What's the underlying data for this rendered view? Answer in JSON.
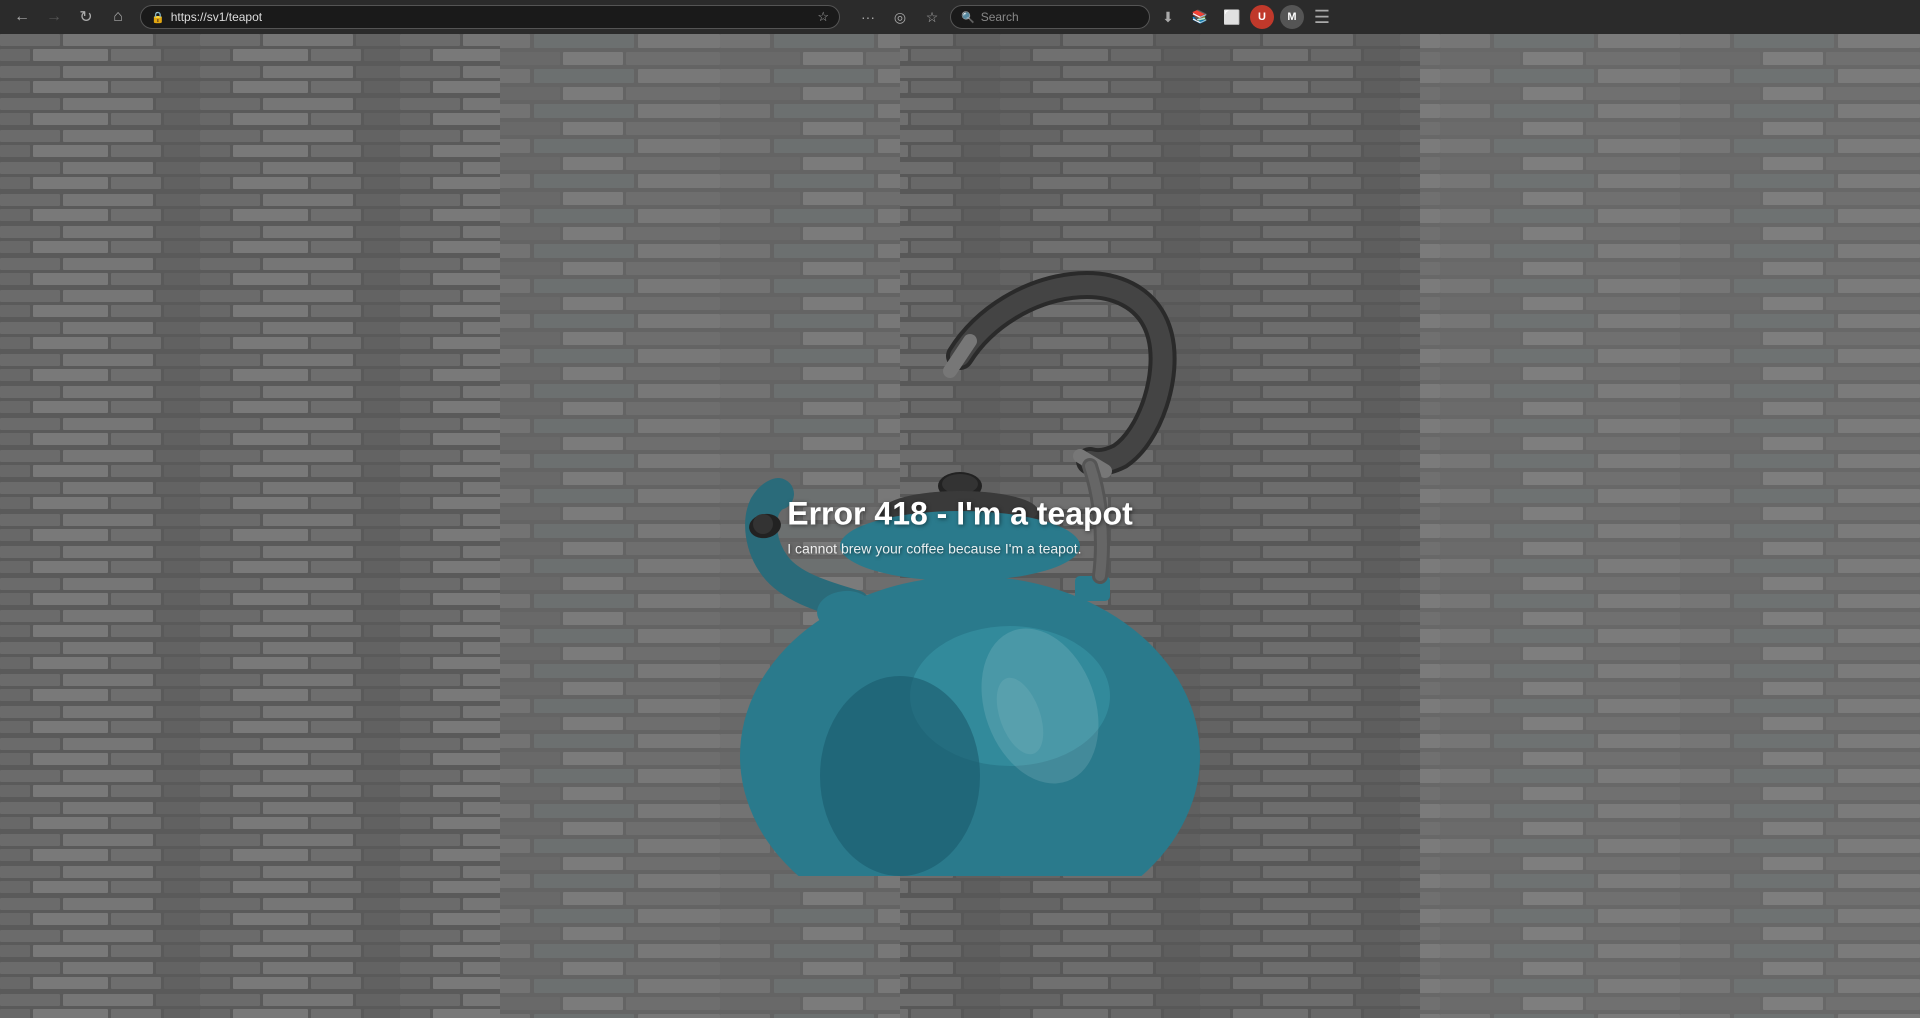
{
  "browser": {
    "back_disabled": false,
    "forward_disabled": true,
    "url": "https://sv1/teapot",
    "search_placeholder": "Search",
    "more_label": "···",
    "menu_label": "☰"
  },
  "page": {
    "error_title": "Error 418 - I'm a teapot",
    "error_subtitle": "I cannot brew your coffee because I'm a teapot.",
    "background_color": "#888888",
    "overlay_color": "rgba(0,0,0,0.35)"
  },
  "icons": {
    "back": "←",
    "forward": "→",
    "reload": "↻",
    "home": "⌂",
    "lock": "🔒",
    "star": "☆",
    "pocket": "◎",
    "more": "···",
    "download": "⬇",
    "library": "📚",
    "tab": "⬜",
    "search_icon": "🔍",
    "menu": "≡"
  }
}
